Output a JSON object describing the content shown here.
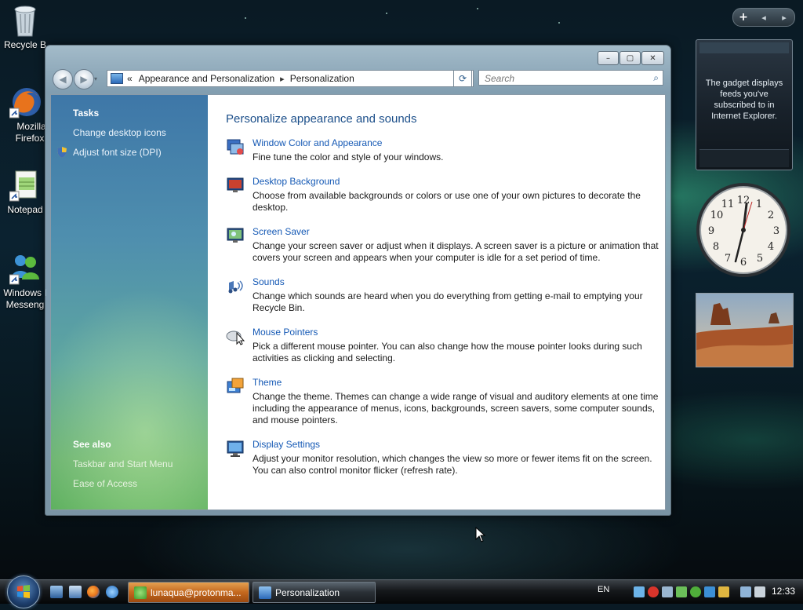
{
  "desktop": {
    "icons": [
      {
        "label": "Recycle B",
        "icon": "recycle-bin-icon"
      },
      {
        "label": "Mozilla Firefox",
        "label_line1": "Mozilla",
        "label_line2": "Firefox",
        "icon": "firefox-icon"
      },
      {
        "label": "Notepad",
        "icon": "notepad-icon"
      },
      {
        "label": "Windows Messeng",
        "label_line1": "Windows I",
        "label_line2": "Messeng",
        "icon": "messenger-icon"
      }
    ]
  },
  "window": {
    "caption_buttons": {
      "minimize": "–",
      "maximize": "▢",
      "close": "✕"
    },
    "nav": {
      "back": "◀",
      "forward": "▶",
      "history": "▾"
    },
    "address": {
      "chevron": "«",
      "crumbs": [
        "Appearance and Personalization",
        "Personalization"
      ],
      "separator": "▸",
      "dropdown": "▾",
      "refresh": "⟳"
    },
    "search": {
      "placeholder": "Search",
      "icon": "⌕"
    },
    "tasks_pane": {
      "tasks_header": "Tasks",
      "tasks": [
        "Change desktop icons",
        "Adjust font size (DPI)"
      ],
      "see_also_header": "See also",
      "see_also": [
        "Taskbar and Start Menu",
        "Ease of Access"
      ]
    },
    "main": {
      "title": "Personalize appearance and sounds",
      "items": [
        {
          "link": "Window Color and Appearance",
          "desc": "Fine tune the color and style of your windows.",
          "icon": "window-color-icon"
        },
        {
          "link": "Desktop Background",
          "desc": "Choose from available backgrounds or colors or use one of your own pictures to decorate the desktop.",
          "icon": "desktop-background-icon"
        },
        {
          "link": "Screen Saver",
          "desc": "Change your screen saver or adjust when it displays. A screen saver is a picture or animation that covers your screen and appears when your computer is idle for a set period of time.",
          "icon": "screen-saver-icon"
        },
        {
          "link": "Sounds",
          "desc": "Change which sounds are heard when you do everything from getting e-mail to emptying your Recycle Bin.",
          "icon": "sounds-icon"
        },
        {
          "link": "Mouse Pointers",
          "desc": "Pick a different mouse pointer. You can also change how the mouse pointer looks during such activities as clicking and selecting.",
          "icon": "mouse-pointers-icon"
        },
        {
          "link": "Theme",
          "desc": "Change the theme. Themes can change a wide range of visual and auditory elements at one time including the appearance of menus, icons, backgrounds, screen savers, some computer sounds, and mouse pointers.",
          "icon": "theme-icon"
        },
        {
          "link": "Display Settings",
          "desc": "Adjust your monitor resolution, which changes the view so more or fewer items fit on the screen. You can also control monitor flicker (refresh rate).",
          "icon": "display-settings-icon"
        }
      ]
    }
  },
  "gadgets": {
    "bar": {
      "add": "+",
      "prev": "◂",
      "next": "▸"
    },
    "feed_text": "The gadget displays feeds you've subscribed to in Internet Explorer.",
    "clock_numbers": [
      "12",
      "1",
      "2",
      "3",
      "4",
      "5",
      "6",
      "7",
      "8",
      "9",
      "10",
      "11"
    ]
  },
  "taskbar": {
    "buttons": [
      {
        "label": "lunaqua@protonma...",
        "icon": "messenger-icon"
      },
      {
        "label": "Personalization",
        "icon": "control-panel-icon"
      }
    ],
    "language": "EN",
    "time": "12:33"
  },
  "colors": {
    "link": "#1559b5",
    "title": "#1c4f8a",
    "tasks_pane_top": "#3e77a8",
    "tasks_pane_bottom": "#5fb160"
  }
}
